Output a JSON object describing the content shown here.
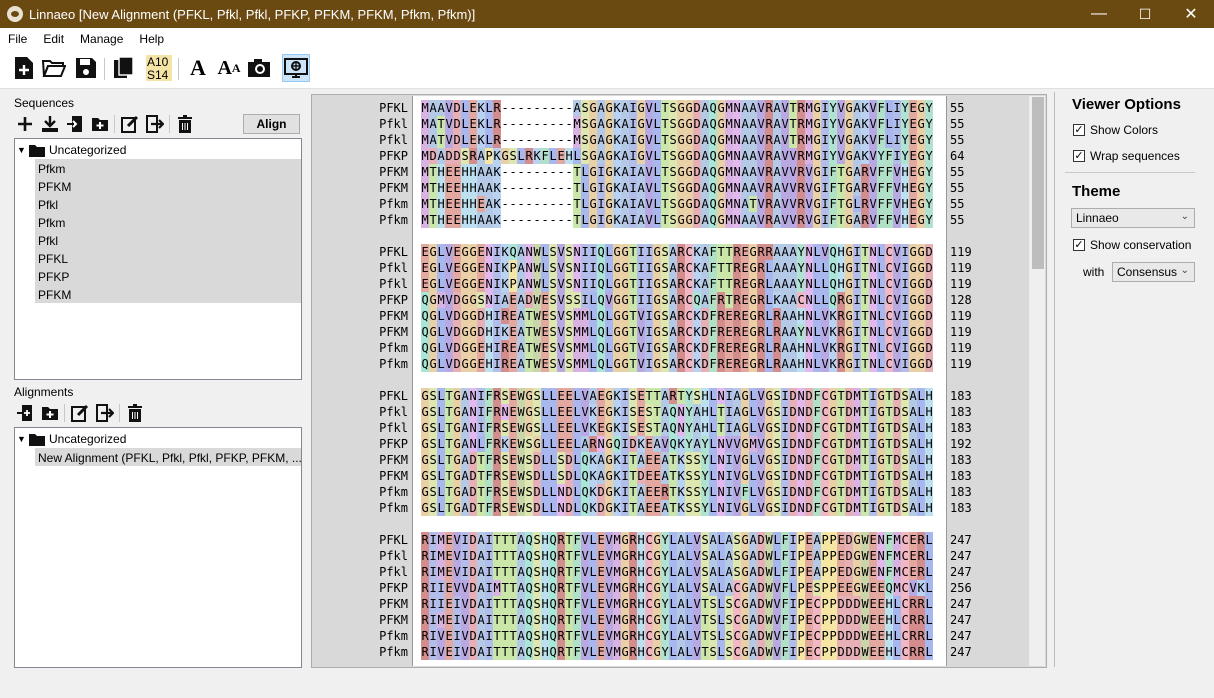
{
  "window": {
    "title": "Linnaeo [New Alignment (PFKL, Pfkl, Pfkl, PFKP, PFKM, PFKM, Pfkm, Pfkm)]",
    "minimize": "—",
    "maximize": "☐",
    "close": "✕"
  },
  "menu": [
    "File",
    "Edit",
    "Manage",
    "Help"
  ],
  "toolbar": {
    "icons": [
      "new-file-icon",
      "open-folder-icon",
      "save-icon",
      "copy-icon",
      "residue-number-icon",
      "font-icon",
      "font-size-icon",
      "screenshot-icon",
      "viewer-options-icon"
    ],
    "residue_label_top": "A10",
    "residue_label_bottom": "S14"
  },
  "sequences": {
    "heading": "Sequences",
    "align_button": "Align",
    "folder": "Uncategorized",
    "items": [
      "Pfkm",
      "PFKM",
      "Pfkl",
      "Pfkm",
      "Pfkl",
      "PFKL",
      "PFKP",
      "PFKM"
    ]
  },
  "alignments": {
    "heading": "Alignments",
    "folder": "Uncategorized",
    "items": [
      "New Alignment (PFKL, Pfkl, Pfkl, PFKP, PFKM, ..."
    ]
  },
  "alignment": {
    "names": [
      "PFKL",
      "Pfkl",
      "Pfkl",
      "PFKP",
      "PFKM",
      "PFKM",
      "Pfkm",
      "Pfkm"
    ],
    "blocks": [
      {
        "rows": [
          "MAAVDLEKLR---------ASGAGKAIGVLTSGGDAQGMNAAVRAVTRMGIYVGAKVFLIYEGY",
          "MATVDLEKLR---------MSGAGKAIGVLTSGGDAQGMNAAVRAVTRMGIYVGAKVFLIYEGY",
          "MATVDLEKLR---------MSGAGKAIGVLTSGGDAQGMNAAVRAVTRMGIYVGAKVFLIYEGY",
          "MDADDSRAPKGSLRKFLEHLSGAGKAIGVLTSGGDAQGMNAAVRAVVRMGIYVGAKVYFIYEGY",
          "MTHEEHHAAK---------TLGIGKAIAVLTSGGDAQGMNAAVRAVVRVGIFTGARVFFVHEGY",
          "MTHEEHHAAK---------TLGIGKAIAVLTSGGDAQGMNAAVRAVVRVGIFTGARVFFVHEGY",
          "MTHEEHHEAK---------TLGIGKAIAVLTSGGDAQGMNATVRAVVRVGIFTGLRVFFVHEGY",
          "MTHEEHHAAK---------TLGIGKAIAVLTSGGDAQGMNAAVRAVVRVGIFTGARVFFVHEGY"
        ],
        "ends": [
          "55",
          "55",
          "55",
          "64",
          "55",
          "55",
          "55",
          "55"
        ]
      },
      {
        "rows": [
          "EGLVEGGENIKQANWLSVSNIIQLGGTIIGSARCKAFTTREGRRAAAYNLVQHGITNLCVIGGD",
          "EGLVEGGENIKPANWLSVSNIIQLGGTIIGSARCKAFTTREGRLAAAYNLLQHGITNLCVIGGD",
          "EGLVEGGENIKPANWLSVSNIIQLGGTIIGSARCKAFTTREGRLAAAYNLLQHGITNLCVIGGD",
          "QGMVDGGSNIAEADWESVSSILQVGGTIIGSARCQAFRTREGRLKAACNLLQRGITNLCVIGGD",
          "QGLVDGGDHIREATWESVSMMLQLGGTVIGSARCKDFREREGRLRAAHNLVKRGITNLCVIGGD",
          "QGLVDGGDHIKEATWESVSMMLQLGGTVIGSARCKDFREREGRLRAAYNLVKRGITNLCVIGGD",
          "QGLVDGGEHIREATWESVSMMLQLGGTVIGSARCKDFREREGRLRAAHNLVKRGITNLCVIGGD",
          "QGLVDGGEHIREATWESVSMMLQLGGTVIGSARCKDFREREGRLRAAHNLVKRGITNLCVIGGD"
        ],
        "ends": [
          "119",
          "119",
          "119",
          "128",
          "119",
          "119",
          "119",
          "119"
        ]
      },
      {
        "rows": [
          "GSLTGANIFRSEWGSLLEELVAEGKISETTARTYSHLNIAGLVGSIDNDFCGTDMTIGTDSALH",
          "GSLTGANIFRNEWGSLLEELVKEGKISESTAQNYAHLTIAGLVGSIDNDFCGTDMTIGTDSALH",
          "GSLTGANIFRSEWGSLLEELVKEGKISESTAQNYAHLTIAGLVGSIDNDFCGTDMTIGTDSALH",
          "GSLTGANLFRKEWSGLLEELARNGQIDKEAVQKYAYLNVVGMVGSIDNDFCGTDMTIGTDSALH",
          "GSLTGADTFRSEWSDLLSDLQKAGKITAEEATKSSYLNIVGLVGSIDNDFCGTDMTIGTDSALH",
          "GSLTGADTFRSEWSDLLSDLQKAGKITDEEATKSSYLNIVGLVGSIDNDFCGTDMTIGTDSALH",
          "GSLTGADTFRSEWSDLLNDLQKDGKITAEERTKSSYLNIVFLVGSIDNDFCGTDMTIGTDSALH",
          "GSLTGADTFRSEWSDLLNDLQKDGKITAEEATKSSYLNIVGLVGSIDNDFCGTDMTIGTDSALH"
        ],
        "ends": [
          "183",
          "183",
          "183",
          "192",
          "183",
          "183",
          "183",
          "183"
        ]
      },
      {
        "rows": [
          "RIMEVIDAITTTAQSHQRTFVLEVMGRHCGYLALVSALASGADWLFIPEAPPEDGWENFMCERL",
          "RIMEVIDAITTTAQSHQRTFVLEVMGRHCGYLALVSALASGADWLFIPEAPPEDGWENFMCERL",
          "RIMEVIDAITTTAQSHQRTFVLEVMGRHCGYLALVSALASGADWLFIPEAPPEDGWENFMCERL",
          "RIIEVVDAIMTTAQSHQRTFVLEVMGRHCGYLALVSALACGADWVFLPESPPEEGWEEQMCVKL",
          "RIIEIVDAITTTAQSHQRTFVLEVMGRHCGYLALVTSLSCGADWVFIPECPPDDDWEEHLCRRL",
          "RIMEIVDAITTTAQSHQRTFVLEVMGRHCGYLALVTSLSCGADWVFIPECPPDDDWEEHLCRRL",
          "RIVEIVDAITTTAQSHQRTFVLEVMGRHCGYLALVTSLSCGADWVFIPECPPDDDWEEHLCRRL",
          "RIVEIVDAITTTAQSHQRTFVLEVMGRHCGYLALVTSLSCGADWVFIPECPPDDDWEEHLCRRL"
        ],
        "ends": [
          "247",
          "247",
          "247",
          "256",
          "247",
          "247",
          "247",
          "247"
        ]
      }
    ]
  },
  "viewer_options": {
    "heading": "Viewer Options",
    "show_colors": "Show Colors",
    "show_colors_checked": true,
    "wrap_sequences": "Wrap sequences",
    "wrap_checked": true,
    "theme_heading": "Theme",
    "theme_value": "Linnaeo",
    "show_conservation": "Show conservation",
    "conservation_checked": true,
    "with_label": "with",
    "with_value": "Consensus"
  },
  "colors": {
    "titlebar": "#6b4a12",
    "selection": "#d9d9d9"
  }
}
